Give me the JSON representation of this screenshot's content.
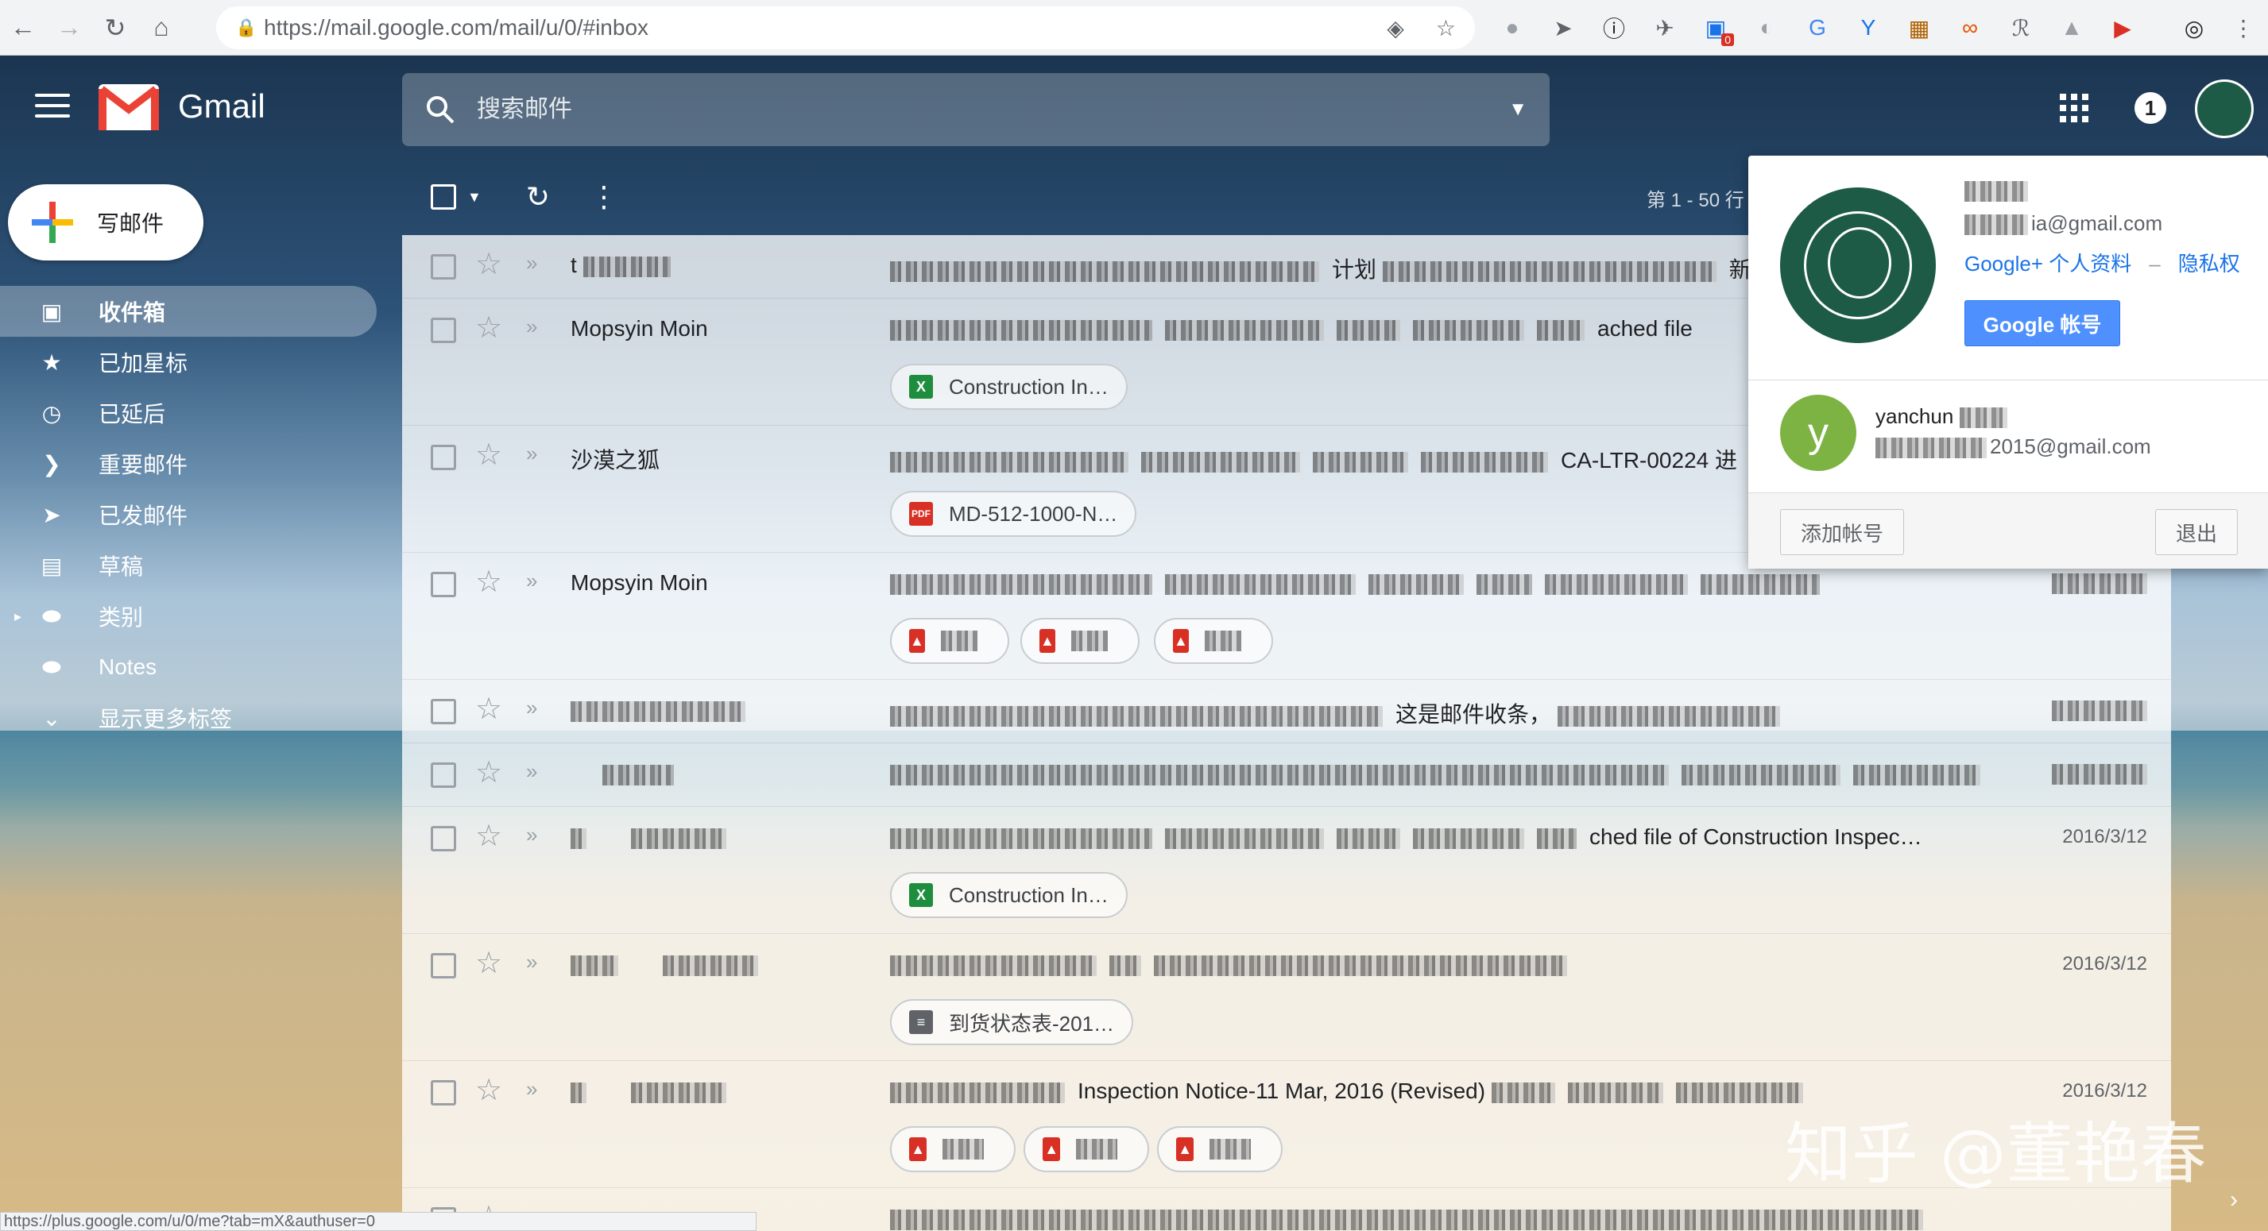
{
  "browser": {
    "url": "https://mail.google.com/mail/u/0/#inbox",
    "status_url": "https://plus.google.com/u/0/me?tab=mX&authuser=0",
    "extensions": [
      "ext-1",
      "ext-2",
      "ext-3",
      "ext-4",
      "ext-5",
      "ext-6",
      "ext-7",
      "ext-8",
      "ext-9",
      "ext-10",
      "ext-11",
      "ext-12",
      "ext-13",
      "ext-14"
    ],
    "extension_badge": "0"
  },
  "header": {
    "app_name": "Gmail",
    "search_placeholder": "搜索邮件",
    "notification_count": "1"
  },
  "sidebar": {
    "compose_label": "写邮件",
    "items": [
      {
        "label": "收件箱",
        "icon": "inbox-icon",
        "active": true
      },
      {
        "label": "已加星标",
        "icon": "star-icon"
      },
      {
        "label": "已延后",
        "icon": "clock-icon"
      },
      {
        "label": "重要邮件",
        "icon": "important-icon"
      },
      {
        "label": "已发邮件",
        "icon": "send-icon"
      },
      {
        "label": "草稿",
        "icon": "draft-icon"
      },
      {
        "label": "类别",
        "icon": "label-icon"
      },
      {
        "label": "Notes",
        "icon": "label-icon"
      },
      {
        "label": "显示更多标签",
        "icon": "chevron-down-icon"
      }
    ]
  },
  "list": {
    "pager": "第 1 - 50 行",
    "rows": [
      {
        "sender": "t",
        "subject": "计划",
        "subject2": "新：要求",
        "date": "",
        "chips": []
      },
      {
        "sender": "Mopsyin Moin",
        "subject": "",
        "subject2": "ached file",
        "date": "",
        "chips": [
          {
            "type": "xls",
            "label": "Construction In…"
          }
        ]
      },
      {
        "sender": "沙漠之狐",
        "subject": "",
        "subject2": "CA-LTR-00224 进",
        "date": "",
        "chips": [
          {
            "type": "pdf",
            "label": "MD-512-1000-N…"
          }
        ]
      },
      {
        "sender": "Mopsyin Moin",
        "subject": "",
        "subject2": "",
        "date": "",
        "chips": [
          {
            "type": "img",
            "label": ""
          },
          {
            "type": "img",
            "label": ""
          },
          {
            "type": "img",
            "label": ""
          }
        ]
      },
      {
        "sender": "",
        "subject": "",
        "subject2": "这是邮件收条，",
        "date": "",
        "chips": []
      },
      {
        "sender": "",
        "subject": "",
        "subject2": "",
        "date": "",
        "chips": []
      },
      {
        "sender": "",
        "subject": "",
        "subject2": "ched file of Construction Inspec…",
        "date": "2016/3/12",
        "chips": [
          {
            "type": "xls",
            "label": "Construction In…"
          }
        ]
      },
      {
        "sender": "",
        "subject": "",
        "subject2": "",
        "date": "2016/3/12",
        "chips": [
          {
            "type": "doc",
            "label": "到货状态表-201…"
          }
        ]
      },
      {
        "sender": "",
        "subject": "Inspection Notice-11 Mar, 2016 (Revised)",
        "subject2": "",
        "date": "2016/3/12",
        "chips": [
          {
            "type": "img",
            "label": ""
          },
          {
            "type": "img",
            "label": ""
          },
          {
            "type": "img",
            "label": ""
          }
        ]
      },
      {
        "sender": "",
        "subject": "",
        "subject2": "",
        "date": "",
        "chips": []
      }
    ]
  },
  "account_popup": {
    "email": "ia@gmail.com",
    "profile_link": "Google+ 个人资料",
    "privacy_link": "隐私权",
    "google_account_button": "Google 帐号",
    "other_account": {
      "initial": "y",
      "name": "yanchun",
      "email": "2015@gmail.com"
    },
    "add_account_button": "添加帐号",
    "sign_out_button": "退出"
  },
  "watermark": "知乎 @董艳春",
  "colors": {
    "gmail_red": "#ea4335",
    "google_blue": "#4d90fe",
    "other_account_green": "#7cb342"
  }
}
